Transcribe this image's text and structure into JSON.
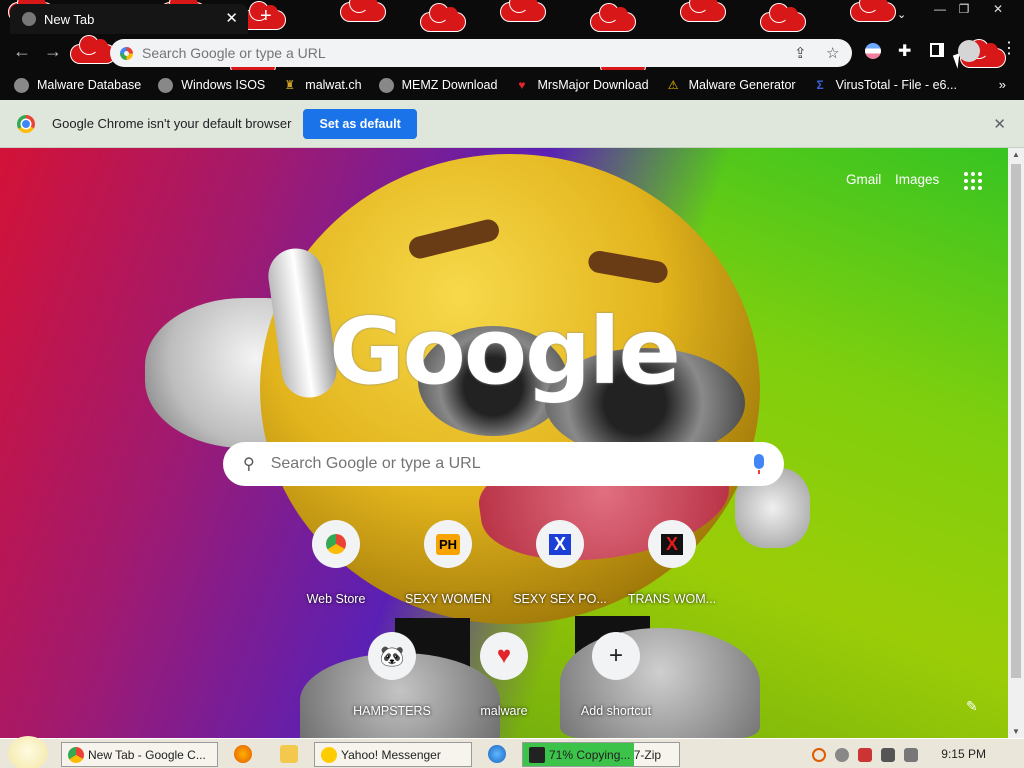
{
  "browser": {
    "tab_title": "New Tab",
    "tab_close": "✕",
    "new_tab": "+",
    "window_controls": [
      "—",
      "❐",
      "✕"
    ],
    "tab_search": "⌄"
  },
  "toolbar": {
    "back": "←",
    "forward": "→",
    "omnibox_placeholder": "Search Google or type a URL",
    "share_icon": "⇪",
    "star_icon": "☆"
  },
  "bookmarks": [
    {
      "label": "Malware Database",
      "icon": "globe-icon",
      "color": "#888888"
    },
    {
      "label": "Windows ISOS",
      "icon": "globe-icon",
      "color": "#888888"
    },
    {
      "label": "malwat.ch",
      "icon": "figure-icon",
      "color": "#c9a227"
    },
    {
      "label": "MEMZ Download",
      "icon": "globe-icon",
      "color": "#888888"
    },
    {
      "label": "MrsMajor Download",
      "icon": "heart-icon",
      "color": "#e3242b"
    },
    {
      "label": "Malware Generator",
      "icon": "warning-icon",
      "color": "#f5c400"
    },
    {
      "label": "VirusTotal - File - e6...",
      "icon": "sigma-icon",
      "color": "#3b61e0"
    }
  ],
  "bookmarks_more": "»",
  "infobar": {
    "message": "Google Chrome isn't your default browser",
    "button": "Set as default",
    "close": "✕"
  },
  "ntp": {
    "gmail": "Gmail",
    "images": "Images",
    "logo": "Google",
    "search_placeholder": "Search Google or type a URL",
    "shortcuts": [
      {
        "label": "Web Store",
        "glyph": "",
        "icon": "chrome-icon"
      },
      {
        "label": "SEXY WOMEN",
        "glyph": "PH",
        "icon": "ph-icon"
      },
      {
        "label": "SEXY SEX PO...",
        "glyph": "X",
        "icon": "x-blue-icon"
      },
      {
        "label": "TRANS WOM...",
        "glyph": "X",
        "icon": "x-red-icon"
      },
      {
        "label": "HAMPSTERS",
        "glyph": "🐼",
        "icon": "raccoon-icon"
      },
      {
        "label": "malware",
        "glyph": "♥",
        "icon": "heart-icon"
      },
      {
        "label": "Add shortcut",
        "glyph": "+",
        "icon": "plus-icon"
      }
    ],
    "customize": "✎"
  },
  "taskbar": {
    "items": [
      {
        "label": "New Tab - Google C...",
        "icon": "chrome-icon"
      },
      {
        "label": "Yahoo! Messenger",
        "icon": "yahoo-icon"
      },
      {
        "label": "71% Copying... 7-Zip",
        "icon": "7zip-icon"
      }
    ],
    "progress": 0.71,
    "clock": "9:15 PM"
  },
  "colors": {
    "accent": "#1a73e8",
    "akatsuki_red": "#d81818"
  }
}
